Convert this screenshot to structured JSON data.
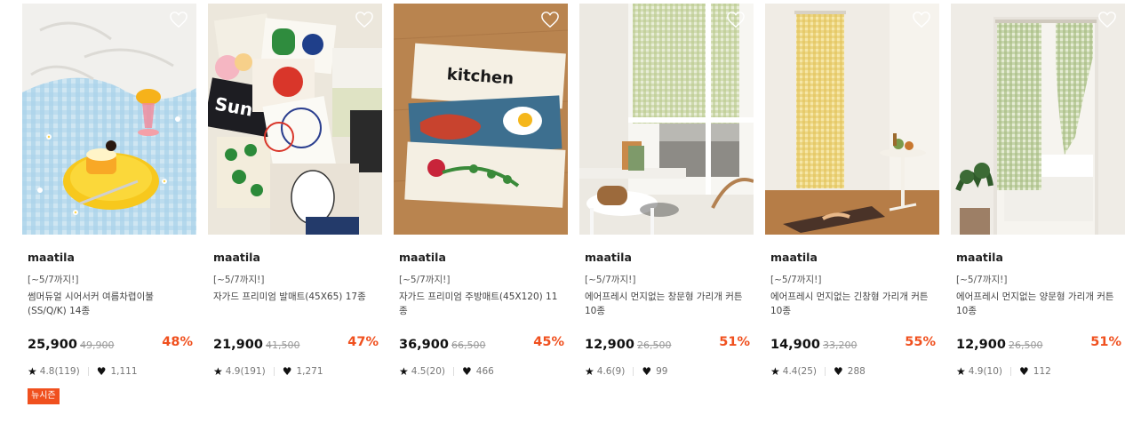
{
  "products": [
    {
      "brand": "maatila",
      "promo": "[~5/7까지!]",
      "name": "썸머듀얼 시어서커 여름차렵이불(SS/Q/K) 14종",
      "price": "25,900",
      "original_price": "49,900",
      "discount": "48%",
      "rating": "4.8(119)",
      "likes": "1,111",
      "badge": "뉴시즌",
      "image": "blue-gingham-blanket-with-cake-photo"
    },
    {
      "brand": "maatila",
      "promo": "[~5/7까지!]",
      "name": "자가드 프리미엄 발매트(45X65) 17종",
      "price": "21,900",
      "original_price": "41,500",
      "discount": "47%",
      "rating": "4.9(191)",
      "likes": "1,271",
      "badge": "",
      "image": "assorted-bath-mats-photo"
    },
    {
      "brand": "maatila",
      "promo": "[~5/7까지!]",
      "name": "자가드 프리미엄 주방매트(45X120) 11종",
      "price": "36,900",
      "original_price": "66,500",
      "discount": "45%",
      "rating": "4.5(20)",
      "likes": "466",
      "badge": "",
      "image": "kitchen-mats-on-wood-floor-photo",
      "mat_text": "kitchen"
    },
    {
      "brand": "maatila",
      "promo": "[~5/7까지!]",
      "name": "에어프레시 먼지없는 창문형 가리개 커튼 10종",
      "price": "12,900",
      "original_price": "26,500",
      "discount": "51%",
      "rating": "4.6(9)",
      "likes": "99",
      "badge": "",
      "image": "window-curtain-room-photo"
    },
    {
      "brand": "maatila",
      "promo": "[~5/7까지!]",
      "name": "에어프레시 먼지없는 긴창형 가리개 커튼 10종",
      "price": "14,900",
      "original_price": "33,200",
      "discount": "55%",
      "rating": "4.4(25)",
      "likes": "288",
      "badge": "",
      "image": "long-yellow-curtain-room-photo"
    },
    {
      "brand": "maatila",
      "promo": "[~5/7까지!]",
      "name": "에어프레시 먼지없는 양문형 가리개 커튼 10종",
      "price": "12,900",
      "original_price": "26,500",
      "discount": "51%",
      "rating": "4.9(10)",
      "likes": "112",
      "badge": "",
      "image": "door-curtain-bedroom-photo"
    }
  ],
  "icons": {
    "star": "star-icon",
    "like": "heart-icon",
    "wishlist": "heart-outline-icon"
  },
  "colors": {
    "discount": "#f0501e",
    "badge_bg": "#f0501e",
    "price": "#111111",
    "original_price": "#999999"
  }
}
